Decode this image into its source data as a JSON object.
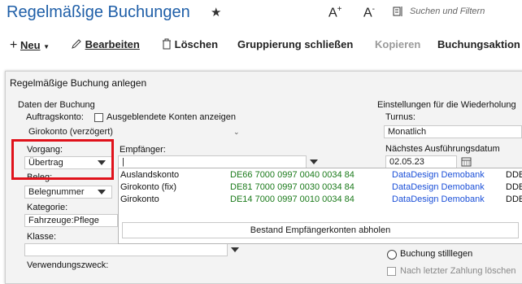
{
  "header": {
    "title": "Regelmäßige Buchungen",
    "font_increase": "A",
    "font_increase_sup": "+",
    "font_decrease": "A",
    "font_decrease_sup": "-",
    "search_placeholder": "Suchen und Filtern"
  },
  "toolbar": {
    "new_label": "Neu",
    "edit_label": "Bearbeiten",
    "delete_label": "Löschen",
    "group_label": "Gruppierung schließen",
    "copy_label": "Kopieren",
    "actions_label": "Buchungsaktion"
  },
  "dialog": {
    "title": "Regelmäßige Buchung anlegen",
    "left": {
      "section_label": "Daten der Buchung",
      "account_label": "Auftragskonto:",
      "show_hidden_label": "Ausgeblendete Konten anzeigen",
      "account_value": "Girokonto (verzögert)",
      "process_label": "Vorgang:",
      "process_value": "Übertrag",
      "receipt_label": "Beleg:",
      "receipt_value": "Belegnummer",
      "category_label": "Kategorie:",
      "category_value": "Fahrzeuge:Pflege",
      "class_label": "Klasse:",
      "class_value": "",
      "purpose_label": "Verwendungszweck:",
      "recipient_label": "Empfänger:",
      "recipient_value": "|"
    },
    "right": {
      "section_label": "Einstellungen für die Wiederholung",
      "cycle_label": "Turnus:",
      "cycle_value": "Monatlich",
      "next_date_label": "Nächstes Ausführungsdatum",
      "next_date_value": "02.05.23",
      "pause_label": "Buchung stilllegen",
      "after_last_label": "Nach letzter Zahlung löschen"
    },
    "recipient_dropdown": {
      "rows": [
        {
          "name": "Auslandskonto",
          "iban": "DE66 7000 0997 0040 0034 84",
          "bank": "DataDesign Demobank",
          "bic": "DDBA"
        },
        {
          "name": "Girokonto (fix)",
          "iban": "DE81 7000 0997 0030 0034 84",
          "bank": "DataDesign Demobank",
          "bic": "DDBA"
        },
        {
          "name": "Girokonto",
          "iban": "DE14 7000 0997 0010 0034 84",
          "bank": "DataDesign Demobank",
          "bic": "DDBA"
        }
      ],
      "fetch_button": "Bestand Empfängerkonten abholen"
    }
  },
  "colors": {
    "title_blue": "#1f5fa8",
    "highlight_red": "#e0121b",
    "iban_green": "#1a7a1a",
    "bank_blue": "#1a4fd8"
  },
  "icons": [
    "star-icon",
    "search-filter-icon",
    "plus-icon",
    "pencil-icon",
    "trash-icon",
    "calendar-icon",
    "dropdown-arrow-icon"
  ]
}
